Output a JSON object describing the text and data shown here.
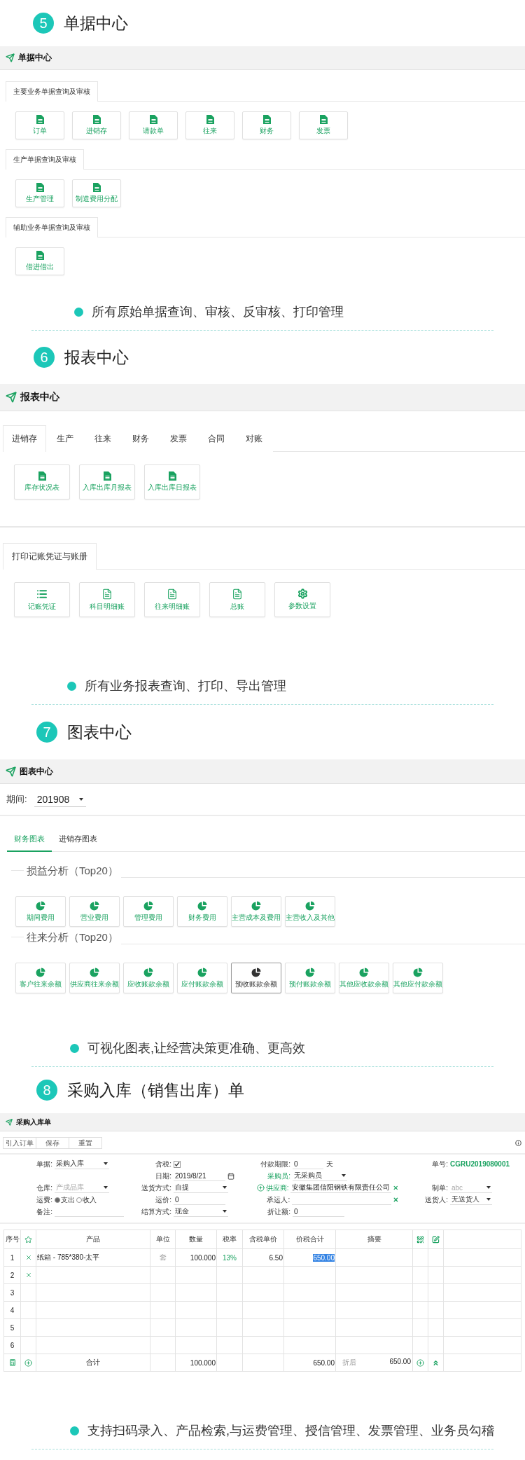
{
  "sections": [
    {
      "kind": "documents",
      "number": "5",
      "title": "单据中心",
      "panel_title": "单据中心",
      "groups": [
        {
          "title": "主要业务单据查询及审核",
          "tiles": [
            "订单",
            "进销存",
            "请款单",
            "往来",
            "财务",
            "发票"
          ]
        },
        {
          "title": "生产单据查询及审核",
          "tiles": [
            "生产管理",
            "制造费用分配"
          ]
        },
        {
          "title": "辅助业务单据查询及审核",
          "tiles": [
            "借进借出"
          ]
        }
      ],
      "bullet": "所有原始单据查询、审核、反审核、打印管理"
    },
    {
      "kind": "reports",
      "number": "6",
      "title": "报表中心",
      "panel_title": "报表中心",
      "tabs": [
        {
          "label": "进销存",
          "selected": true
        },
        {
          "label": "生产",
          "selected": false
        },
        {
          "label": "往来",
          "selected": false
        },
        {
          "label": "财务",
          "selected": false
        },
        {
          "label": "发票",
          "selected": false
        },
        {
          "label": "合同",
          "selected": false
        },
        {
          "label": "对账",
          "selected": false
        }
      ],
      "tiles": [
        {
          "label": "库存状况表",
          "kind": "doc"
        },
        {
          "label": "入库出库月报表",
          "kind": "doc"
        },
        {
          "label": "入库出库日报表",
          "kind": "doc"
        }
      ],
      "print_tabs": [
        {
          "label": "打印记账凭证与账册",
          "selected": true
        }
      ],
      "print_tiles": [
        {
          "label": "记账凭证",
          "kind": "list"
        },
        {
          "label": "科目明细账",
          "kind": "page"
        },
        {
          "label": "往来明细账",
          "kind": "page"
        },
        {
          "label": "总账",
          "kind": "page"
        },
        {
          "label": "参数设置",
          "kind": "gear"
        }
      ],
      "bullet": "所有业务报表查询、打印、导出管理"
    },
    {
      "kind": "charts",
      "number": "7",
      "title": "图表中心",
      "panel_title": "图表中心",
      "period": {
        "label": "期间:",
        "value": "201908"
      },
      "tabs": [
        {
          "label": "财务图表",
          "selected": true
        },
        {
          "label": "进销存图表",
          "selected": false
        }
      ],
      "groups": [
        {
          "title": "损益分析（Top20）",
          "tiles": [
            {
              "label": "期间费用",
              "selected": false
            },
            {
              "label": "营业费用",
              "selected": false
            },
            {
              "label": "管理费用",
              "selected": false
            },
            {
              "label": "财务费用",
              "selected": false
            },
            {
              "label": "主营成本及费用",
              "selected": false
            },
            {
              "label": "主营收入及其他",
              "selected": false
            }
          ]
        },
        {
          "title": "往来分析（Top20）",
          "tiles": [
            {
              "label": "客户往来余额",
              "selected": false
            },
            {
              "label": "供应商往来余额",
              "selected": false
            },
            {
              "label": "应收账款余额",
              "selected": false
            },
            {
              "label": "应付账款余额",
              "selected": false
            },
            {
              "label": "预收账款余额",
              "selected": true
            },
            {
              "label": "预付账款余额",
              "selected": false
            },
            {
              "label": "其他应收款余额",
              "selected": false
            },
            {
              "label": "其他应付款余额",
              "selected": false
            }
          ]
        }
      ],
      "bullet": "可视化图表,让经营决策更准确、更高效"
    },
    {
      "kind": "form",
      "number": "8",
      "title": "采购入库（销售出库）单",
      "panel_title": "采购入库单",
      "toolbar": [
        "引入订单",
        "保存",
        "重置"
      ],
      "form_rows": [
        [
          {
            "kind": "select",
            "label": "单据:",
            "value": "采购入库",
            "disabled": false,
            "highlighted": false
          },
          {
            "kind": "checkbox",
            "label": "含税:",
            "checked": true,
            "highlighted": false
          },
          {
            "kind": "text",
            "label": "付款期限:",
            "value": "0",
            "suffix": "天",
            "highlighted": false
          },
          {
            "kind": "code",
            "label": "单号:",
            "value": "CGRU2019080001",
            "highlighted": false
          }
        ],
        [
          {
            "kind": "blank"
          },
          {
            "kind": "date",
            "label": "日期:",
            "value": "2019/8/21",
            "highlighted": false
          },
          {
            "kind": "select",
            "label": "采购员:",
            "value": "无采购员",
            "disabled": false,
            "highlighted": true
          },
          {
            "kind": "blank"
          }
        ],
        [
          {
            "kind": "select",
            "label": "仓库:",
            "value": "产成品库",
            "disabled": true,
            "highlighted": false
          },
          {
            "kind": "select",
            "label": "送货方式:",
            "value": "自提",
            "disabled": false,
            "highlighted": false
          },
          {
            "kind": "lookup",
            "label": "供应商:",
            "value": "安徽集团信阳钢铁有限责任公司",
            "addable": true,
            "highlighted": true
          },
          {
            "kind": "select",
            "label": "制单:",
            "value": "abc",
            "disabled": true,
            "highlighted": false
          }
        ],
        [
          {
            "kind": "radio",
            "label": "运费:",
            "highlighted": false,
            "options": [
              {
                "label": "支出",
                "selected": true
              },
              {
                "label": "收入",
                "selected": false
              }
            ]
          },
          {
            "kind": "text",
            "label": "运价:",
            "value": "0",
            "highlighted": false
          },
          {
            "kind": "lookup",
            "label": "承运人:",
            "addable": false,
            "highlighted": false
          },
          {
            "kind": "select",
            "label": "送货人:",
            "value": "无送货人",
            "disabled": false,
            "highlighted": false
          }
        ],
        [
          {
            "kind": "text",
            "label": "备注:",
            "highlighted": false
          },
          {
            "kind": "select",
            "label": "结算方式:",
            "value": "现金",
            "disabled": false,
            "highlighted": false
          },
          {
            "kind": "text",
            "label": "折让额:",
            "value": "0",
            "highlighted": false
          }
        ]
      ],
      "table": {
        "columns": [
          "序号",
          "产品",
          "单位",
          "数量",
          "税率",
          "含税单价",
          "价税合计",
          "摘要"
        ],
        "rows": [
          {
            "index": "1",
            "removable": true,
            "product": "纸箱 - 785*380-太平",
            "unit": "套",
            "quantity": "100.000",
            "tax_rate": "13%",
            "unit_price": "6.50",
            "total": "650.00",
            "total_selected": true
          },
          {
            "index": "2",
            "removable": true
          },
          {
            "index": "3",
            "removable": false
          },
          {
            "index": "4",
            "removable": false
          },
          {
            "index": "5",
            "removable": false
          },
          {
            "index": "6",
            "removable": false
          }
        ],
        "footer": {
          "label": "合计",
          "quantity": "100.000",
          "total": "650.00",
          "discount_label": "折后",
          "discount_total": "650.00"
        }
      },
      "bullet": "支持扫码录入、产品检索,与运费管理、授信管理、发票管理、业务员勾稽"
    }
  ]
}
